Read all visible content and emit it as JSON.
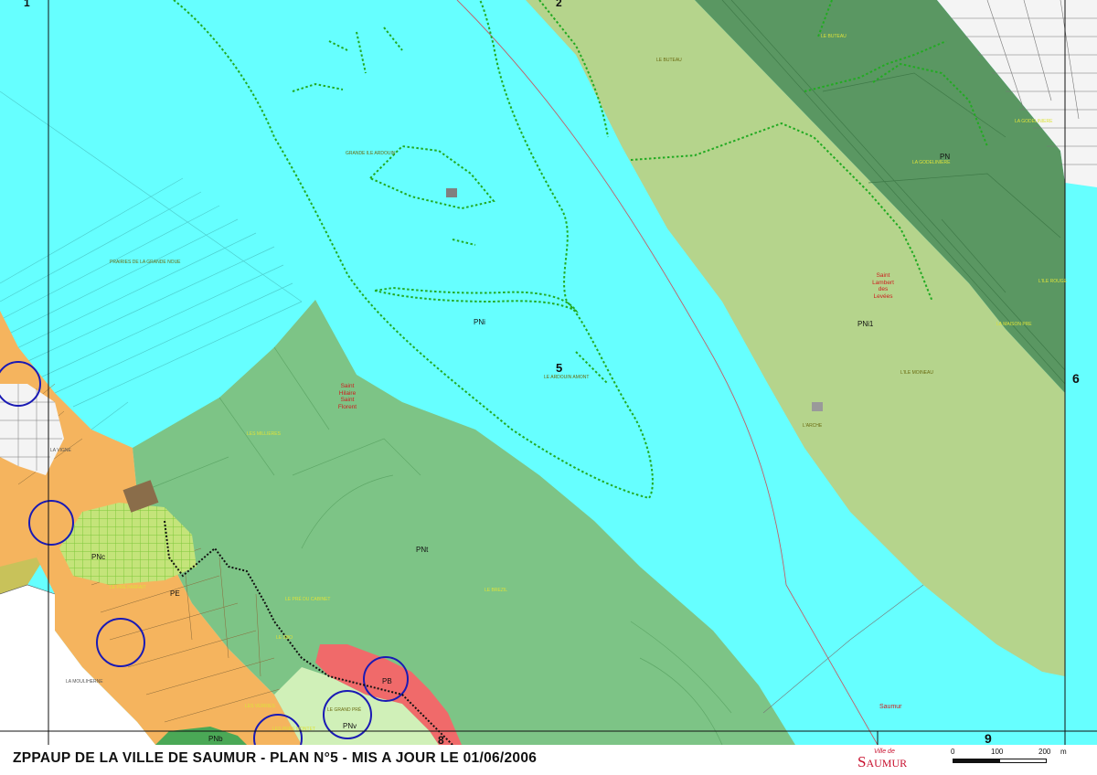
{
  "map": {
    "grid_labels": [
      "1",
      "2",
      "6",
      "9",
      "8"
    ],
    "parcel_numbers": [
      "5"
    ],
    "zone_codes": {
      "pni": "PNi",
      "pni1": "PNi1",
      "pn": "PN",
      "pnt": "PNt",
      "pnc": "PNc",
      "pe": "PE",
      "pb": "PB",
      "pnv": "PNv",
      "pnb": "PNb"
    },
    "towns": {
      "saint_hilaire": [
        "Saint",
        "Hilaire",
        "Saint",
        "Florent"
      ],
      "saint_lambert": [
        "Saint",
        "Lambert",
        "des",
        "Levées"
      ],
      "saumur": "Saumur"
    },
    "places": {
      "le_buteau": "LE BUTEAU",
      "le_buteau_top": "LE BUTEAU",
      "grande_ile": "GRANDE ILE ARDOUIN",
      "ardouin_amont": "LE ARDOUIN AMONT",
      "prairies": "PRAIRIES DE LA GRANDE NOUE",
      "millieres": "LES MILLIERES",
      "godeliniere": "LA GODELINIERE",
      "godeliniere2": "LA GODELINIERE",
      "ile_rouge": "L'ILE ROUGE",
      "maison_pre": "LA MAISON PRE",
      "ile_moineau": "L'ILE MOINEAU",
      "arche": "L'ARCHE",
      "le_brezil": "LE BREZIL",
      "pre_cabinet": "LE PRÉ DU CABINET",
      "pre_parfait": "LE PRÉ PARFAIT",
      "les_verries": "LES VERRIES",
      "grand_pre": "LE GRAND PRÉ",
      "pres_montet": "LES PRÉS MONTET",
      "le_sbo": "LE SBO",
      "mouliherne": "LA MOULIHERNE",
      "vigne": "LA VIGNE"
    }
  },
  "footer": {
    "title": "ZPPAUP DE LA VILLE DE SAUMUR - PLAN N°5 - MIS A JOUR LE  01/06/2006",
    "logo_small": "Ville de",
    "logo_main": "Saumur"
  },
  "scale": {
    "labels": [
      "0",
      "100",
      "200",
      "m"
    ]
  },
  "colors": {
    "water": "#66ffff",
    "natural_green": "#7dc486",
    "light_olive": "#b5d48c",
    "dark_green": "#5a9762",
    "urban_orange": "#f5b45e",
    "protected_red": "#f06a6a",
    "pale_green": "#d0f0b8",
    "olive_gold": "#c8c25a",
    "hatch_green": "#a8d860",
    "boundary_green": "#22aa22",
    "circle_blue": "#1a1ab4",
    "town_red": "#cc2020"
  }
}
